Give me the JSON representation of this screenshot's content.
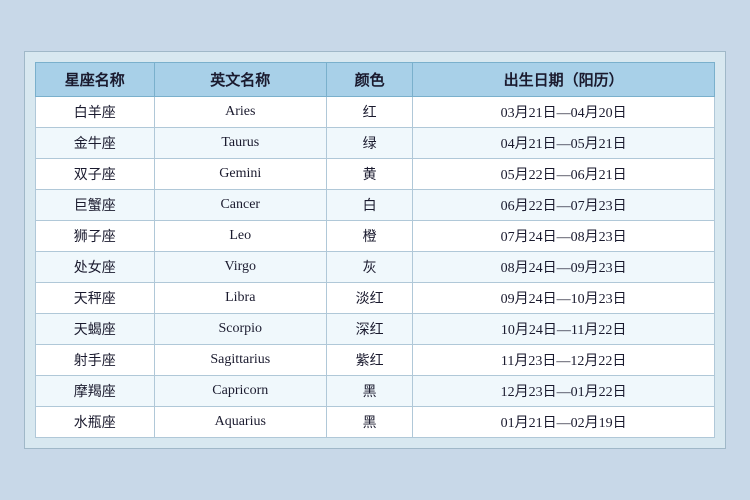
{
  "table": {
    "headers": [
      "星座名称",
      "英文名称",
      "颜色",
      "出生日期（阳历）"
    ],
    "rows": [
      {
        "zh": "白羊座",
        "en": "Aries",
        "color": "红",
        "date": "03月21日—04月20日"
      },
      {
        "zh": "金牛座",
        "en": "Taurus",
        "color": "绿",
        "date": "04月21日—05月21日"
      },
      {
        "zh": "双子座",
        "en": "Gemini",
        "color": "黄",
        "date": "05月22日—06月21日"
      },
      {
        "zh": "巨蟹座",
        "en": "Cancer",
        "color": "白",
        "date": "06月22日—07月23日"
      },
      {
        "zh": "狮子座",
        "en": "Leo",
        "color": "橙",
        "date": "07月24日—08月23日"
      },
      {
        "zh": "处女座",
        "en": "Virgo",
        "color": "灰",
        "date": "08月24日—09月23日"
      },
      {
        "zh": "天秤座",
        "en": "Libra",
        "color": "淡红",
        "date": "09月24日—10月23日"
      },
      {
        "zh": "天蝎座",
        "en": "Scorpio",
        "color": "深红",
        "date": "10月24日—11月22日"
      },
      {
        "zh": "射手座",
        "en": "Sagittarius",
        "color": "紫红",
        "date": "11月23日—12月22日"
      },
      {
        "zh": "摩羯座",
        "en": "Capricorn",
        "color": "黑",
        "date": "12月23日—01月22日"
      },
      {
        "zh": "水瓶座",
        "en": "Aquarius",
        "color": "黑",
        "date": "01月21日—02月19日"
      }
    ]
  }
}
